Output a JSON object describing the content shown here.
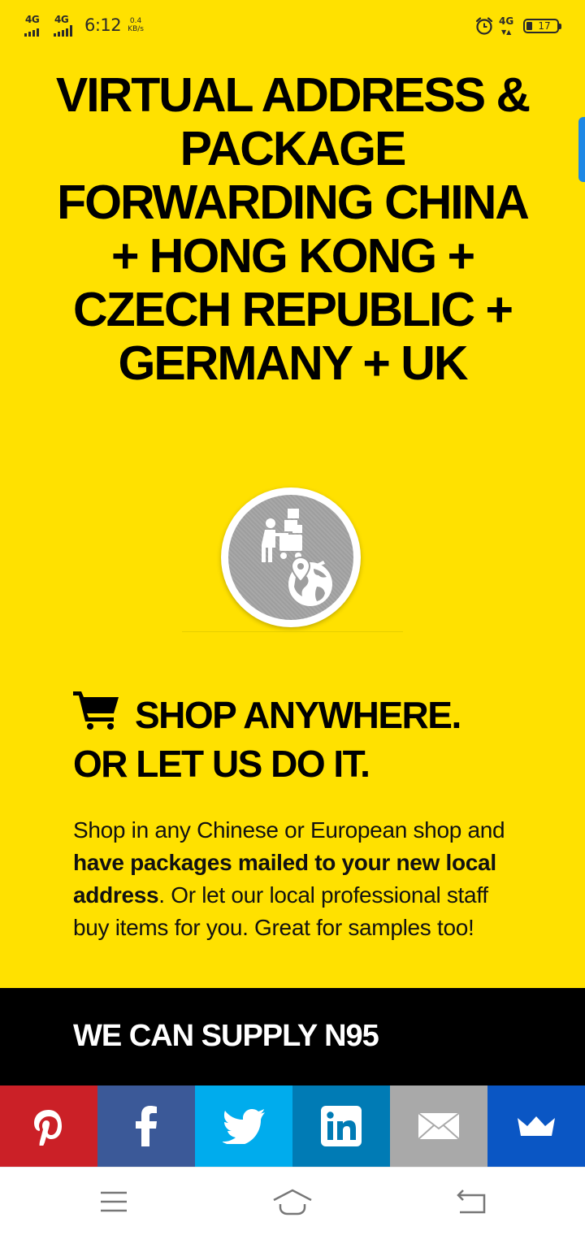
{
  "status_bar": {
    "network_1": "4G",
    "network_2": "4G",
    "time": "6:12",
    "speed_value": "0.4",
    "speed_unit": "KB/s",
    "network_right": "4G",
    "battery_level": "17"
  },
  "hero": {
    "title": "VIRTUAL ADDRESS & PACKAGE FORWARDING CHINA + HONG KONG + CZECH REPUBLIC + GERMANY + UK"
  },
  "shop_section": {
    "heading_line1": "SHOP ANYWHERE.",
    "heading_line2": "OR LET US DO IT.",
    "text_before": "Shop in any Chinese or European shop and ",
    "text_bold": "have packages mailed to your new local address",
    "text_after": ". Or let our local professional staff buy items for you. Great for samples too!"
  },
  "supply_band": {
    "title": "WE CAN SUPPLY N95"
  },
  "share_bar": {
    "buttons": [
      {
        "name": "pinterest",
        "icon": "pinterest-icon",
        "color": "#cb2027"
      },
      {
        "name": "facebook",
        "icon": "facebook-icon",
        "color": "#3b5998"
      },
      {
        "name": "twitter",
        "icon": "twitter-icon",
        "color": "#00aced"
      },
      {
        "name": "linkedin",
        "icon": "linkedin-icon",
        "color": "#007bb5"
      },
      {
        "name": "email",
        "icon": "email-icon",
        "color": "#a9a9a9"
      },
      {
        "name": "sumo",
        "icon": "crown-icon",
        "color": "#0a56c4"
      }
    ]
  },
  "colors": {
    "page_background": "#ffe100",
    "band_background": "#000000",
    "nav_background": "#ffffff"
  },
  "nav_bar": {
    "icons": [
      "menu-icon",
      "home-icon",
      "back-icon"
    ]
  }
}
